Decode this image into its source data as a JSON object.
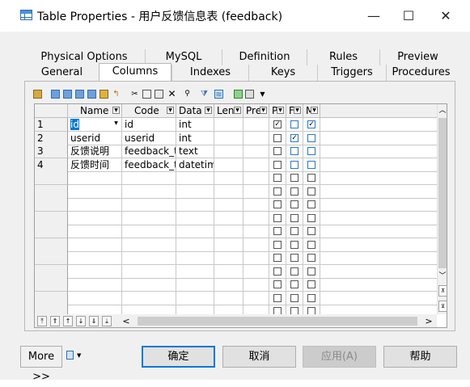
{
  "window": {
    "title": "Table Properties - 用户反馈信息表 (feedback)",
    "minimize": "—",
    "maximize": "☐",
    "close": "✕"
  },
  "tabs_row1": [
    "Physical Options",
    "MySQL",
    "Definition",
    "Rules",
    "Preview"
  ],
  "tabs_row2": [
    "General",
    "Columns",
    "Indexes",
    "Keys",
    "Triggers",
    "Procedures"
  ],
  "active_tab": "Columns",
  "grid": {
    "headers": [
      "Name",
      "Code",
      "Data",
      "Len",
      "Pre",
      "P",
      "F",
      "M"
    ],
    "rows": [
      {
        "num": "1",
        "name": "id",
        "code": "id",
        "data": "int",
        "p": true,
        "f": false,
        "m": true
      },
      {
        "num": "2",
        "name": "userid",
        "code": "userid",
        "data": "int",
        "p": false,
        "f": true,
        "m": false
      },
      {
        "num": "3",
        "name": "反馈说明",
        "code": "feedback_te",
        "data": "text",
        "p": false,
        "f": false,
        "m": false
      },
      {
        "num": "4",
        "name": "反馈时间",
        "code": "feedback_ti",
        "data": "datetime",
        "p": false,
        "f": false,
        "m": false
      }
    ],
    "empty_rows": 11
  },
  "buttons": {
    "more": "More >>",
    "ok": "确定",
    "cancel": "取消",
    "apply": "应用(A)",
    "help": "帮助"
  },
  "colors": {
    "accent": "#0078d7",
    "checkbox_blue": "#2a77c9"
  }
}
